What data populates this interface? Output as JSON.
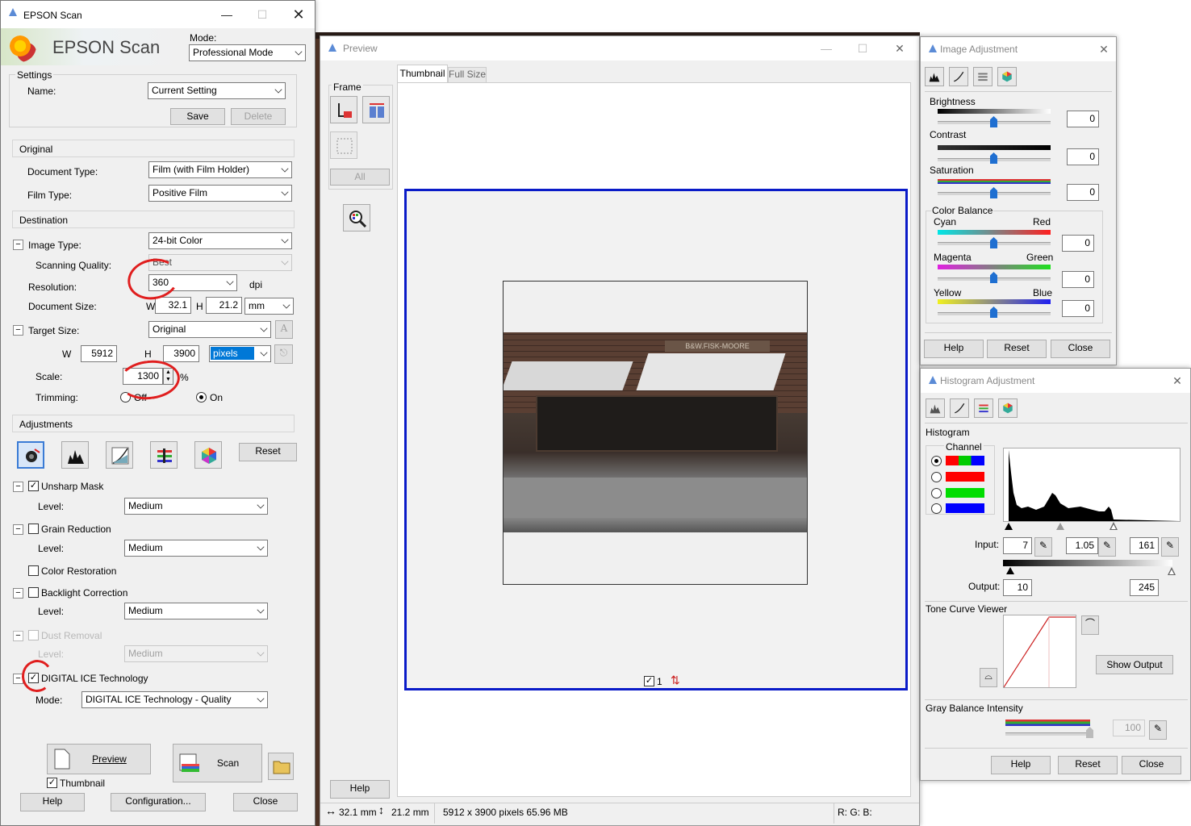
{
  "colors": {
    "accent": "#1f6fd1",
    "preview_border": "#0a1bc8",
    "annotation": "#e01e1e",
    "panel": "#f0f0f0"
  },
  "main": {
    "title": "EPSON Scan",
    "logo_text": "EPSON Scan",
    "mode_label": "Mode:",
    "mode_value": "Professional Mode",
    "settings_header": "Settings",
    "name_label": "Name:",
    "name_value": "Current Setting",
    "save": "Save",
    "delete": "Delete",
    "original_header": "Original",
    "doc_type_label": "Document Type:",
    "doc_type_value": "Film (with Film Holder)",
    "film_type_label": "Film Type:",
    "film_type_value": "Positive Film",
    "destination_header": "Destination",
    "image_type_label": "Image Type:",
    "image_type_value": "24-bit Color",
    "scan_quality_label": "Scanning Quality:",
    "scan_quality_value": "Best",
    "resolution_label": "Resolution:",
    "resolution_value": "360",
    "dpi": "dpi",
    "doc_size_label": "Document Size:",
    "w_label": "W",
    "doc_w": "32.1",
    "h_label": "H",
    "doc_h": "21.2",
    "unit_mm": "mm",
    "target_size_label": "Target Size:",
    "target_size_value": "Original",
    "target_w": "5912",
    "target_h": "3900",
    "unit_pixels": "pixels",
    "scale_label": "Scale:",
    "scale_value": "1300",
    "percent": "%",
    "trimming_label": "Trimming:",
    "off": "Off",
    "on": "On",
    "adjustments_header": "Adjustments",
    "reset": "Reset",
    "unsharp": "Unsharp Mask",
    "level_label": "Level:",
    "medium": "Medium",
    "grain": "Grain Reduction",
    "color_restoration": "Color Restoration",
    "backlight": "Backlight Correction",
    "dust": "Dust Removal",
    "ice": "DIGITAL ICE Technology",
    "mode2_label": "Mode:",
    "ice_mode": "DIGITAL ICE Technology - Quality",
    "preview_btn": "Preview",
    "scan_btn": "Scan",
    "thumbnail": "Thumbnail",
    "help": "Help",
    "configuration": "Configuration...",
    "close": "Close"
  },
  "preview": {
    "title": "Preview",
    "frame_label": "Frame",
    "all": "All",
    "tab_thumbnail": "Thumbnail",
    "tab_fullsize": "Full Size",
    "frame_number": "1",
    "photo_sign": "B&W.FISK-MOORE",
    "help": "Help",
    "status_w": "32.1 mm",
    "status_h": "21.2 mm",
    "status_size": "5912 x 3900 pixels 65.96 MB",
    "status_rgb": "R: G: B:"
  },
  "image_adj": {
    "title": "Image Adjustment",
    "brightness": "Brightness",
    "brightness_val": "0",
    "contrast": "Contrast",
    "contrast_val": "0",
    "saturation": "Saturation",
    "saturation_val": "0",
    "color_balance": "Color Balance",
    "cyan": "Cyan",
    "red": "Red",
    "cr_val": "0",
    "magenta": "Magenta",
    "green": "Green",
    "mg_val": "0",
    "yellow": "Yellow",
    "blue": "Blue",
    "yb_val": "0",
    "help": "Help",
    "reset": "Reset",
    "close": "Close"
  },
  "histo": {
    "title": "Histogram Adjustment",
    "histogram_label": "Histogram",
    "channel_label": "Channel",
    "input_label": "Input:",
    "input_low": "7",
    "input_gamma": "1.05",
    "input_high": "161",
    "output_label": "Output:",
    "output_low": "10",
    "output_high": "245",
    "tone_curve": "Tone Curve Viewer",
    "show_output": "Show Output",
    "gray_balance": "Gray Balance Intensity",
    "gray_val": "100",
    "help": "Help",
    "reset": "Reset",
    "close": "Close"
  }
}
